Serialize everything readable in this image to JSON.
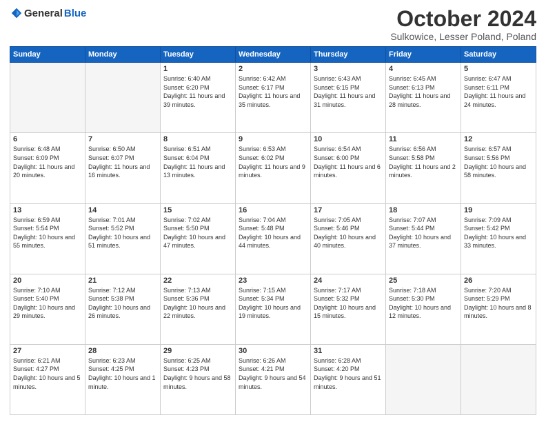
{
  "logo": {
    "general": "General",
    "blue": "Blue"
  },
  "header": {
    "month": "October 2024",
    "location": "Sulkowice, Lesser Poland, Poland"
  },
  "weekdays": [
    "Sunday",
    "Monday",
    "Tuesday",
    "Wednesday",
    "Thursday",
    "Friday",
    "Saturday"
  ],
  "weeks": [
    [
      {
        "day": "",
        "empty": true
      },
      {
        "day": "",
        "empty": true
      },
      {
        "day": "1",
        "sunrise": "Sunrise: 6:40 AM",
        "sunset": "Sunset: 6:20 PM",
        "daylight": "Daylight: 11 hours and 39 minutes."
      },
      {
        "day": "2",
        "sunrise": "Sunrise: 6:42 AM",
        "sunset": "Sunset: 6:17 PM",
        "daylight": "Daylight: 11 hours and 35 minutes."
      },
      {
        "day": "3",
        "sunrise": "Sunrise: 6:43 AM",
        "sunset": "Sunset: 6:15 PM",
        "daylight": "Daylight: 11 hours and 31 minutes."
      },
      {
        "day": "4",
        "sunrise": "Sunrise: 6:45 AM",
        "sunset": "Sunset: 6:13 PM",
        "daylight": "Daylight: 11 hours and 28 minutes."
      },
      {
        "day": "5",
        "sunrise": "Sunrise: 6:47 AM",
        "sunset": "Sunset: 6:11 PM",
        "daylight": "Daylight: 11 hours and 24 minutes."
      }
    ],
    [
      {
        "day": "6",
        "sunrise": "Sunrise: 6:48 AM",
        "sunset": "Sunset: 6:09 PM",
        "daylight": "Daylight: 11 hours and 20 minutes."
      },
      {
        "day": "7",
        "sunrise": "Sunrise: 6:50 AM",
        "sunset": "Sunset: 6:07 PM",
        "daylight": "Daylight: 11 hours and 16 minutes."
      },
      {
        "day": "8",
        "sunrise": "Sunrise: 6:51 AM",
        "sunset": "Sunset: 6:04 PM",
        "daylight": "Daylight: 11 hours and 13 minutes."
      },
      {
        "day": "9",
        "sunrise": "Sunrise: 6:53 AM",
        "sunset": "Sunset: 6:02 PM",
        "daylight": "Daylight: 11 hours and 9 minutes."
      },
      {
        "day": "10",
        "sunrise": "Sunrise: 6:54 AM",
        "sunset": "Sunset: 6:00 PM",
        "daylight": "Daylight: 11 hours and 6 minutes."
      },
      {
        "day": "11",
        "sunrise": "Sunrise: 6:56 AM",
        "sunset": "Sunset: 5:58 PM",
        "daylight": "Daylight: 11 hours and 2 minutes."
      },
      {
        "day": "12",
        "sunrise": "Sunrise: 6:57 AM",
        "sunset": "Sunset: 5:56 PM",
        "daylight": "Daylight: 10 hours and 58 minutes."
      }
    ],
    [
      {
        "day": "13",
        "sunrise": "Sunrise: 6:59 AM",
        "sunset": "Sunset: 5:54 PM",
        "daylight": "Daylight: 10 hours and 55 minutes."
      },
      {
        "day": "14",
        "sunrise": "Sunrise: 7:01 AM",
        "sunset": "Sunset: 5:52 PM",
        "daylight": "Daylight: 10 hours and 51 minutes."
      },
      {
        "day": "15",
        "sunrise": "Sunrise: 7:02 AM",
        "sunset": "Sunset: 5:50 PM",
        "daylight": "Daylight: 10 hours and 47 minutes."
      },
      {
        "day": "16",
        "sunrise": "Sunrise: 7:04 AM",
        "sunset": "Sunset: 5:48 PM",
        "daylight": "Daylight: 10 hours and 44 minutes."
      },
      {
        "day": "17",
        "sunrise": "Sunrise: 7:05 AM",
        "sunset": "Sunset: 5:46 PM",
        "daylight": "Daylight: 10 hours and 40 minutes."
      },
      {
        "day": "18",
        "sunrise": "Sunrise: 7:07 AM",
        "sunset": "Sunset: 5:44 PM",
        "daylight": "Daylight: 10 hours and 37 minutes."
      },
      {
        "day": "19",
        "sunrise": "Sunrise: 7:09 AM",
        "sunset": "Sunset: 5:42 PM",
        "daylight": "Daylight: 10 hours and 33 minutes."
      }
    ],
    [
      {
        "day": "20",
        "sunrise": "Sunrise: 7:10 AM",
        "sunset": "Sunset: 5:40 PM",
        "daylight": "Daylight: 10 hours and 29 minutes."
      },
      {
        "day": "21",
        "sunrise": "Sunrise: 7:12 AM",
        "sunset": "Sunset: 5:38 PM",
        "daylight": "Daylight: 10 hours and 26 minutes."
      },
      {
        "day": "22",
        "sunrise": "Sunrise: 7:13 AM",
        "sunset": "Sunset: 5:36 PM",
        "daylight": "Daylight: 10 hours and 22 minutes."
      },
      {
        "day": "23",
        "sunrise": "Sunrise: 7:15 AM",
        "sunset": "Sunset: 5:34 PM",
        "daylight": "Daylight: 10 hours and 19 minutes."
      },
      {
        "day": "24",
        "sunrise": "Sunrise: 7:17 AM",
        "sunset": "Sunset: 5:32 PM",
        "daylight": "Daylight: 10 hours and 15 minutes."
      },
      {
        "day": "25",
        "sunrise": "Sunrise: 7:18 AM",
        "sunset": "Sunset: 5:30 PM",
        "daylight": "Daylight: 10 hours and 12 minutes."
      },
      {
        "day": "26",
        "sunrise": "Sunrise: 7:20 AM",
        "sunset": "Sunset: 5:29 PM",
        "daylight": "Daylight: 10 hours and 8 minutes."
      }
    ],
    [
      {
        "day": "27",
        "sunrise": "Sunrise: 6:21 AM",
        "sunset": "Sunset: 4:27 PM",
        "daylight": "Daylight: 10 hours and 5 minutes."
      },
      {
        "day": "28",
        "sunrise": "Sunrise: 6:23 AM",
        "sunset": "Sunset: 4:25 PM",
        "daylight": "Daylight: 10 hours and 1 minute."
      },
      {
        "day": "29",
        "sunrise": "Sunrise: 6:25 AM",
        "sunset": "Sunset: 4:23 PM",
        "daylight": "Daylight: 9 hours and 58 minutes."
      },
      {
        "day": "30",
        "sunrise": "Sunrise: 6:26 AM",
        "sunset": "Sunset: 4:21 PM",
        "daylight": "Daylight: 9 hours and 54 minutes."
      },
      {
        "day": "31",
        "sunrise": "Sunrise: 6:28 AM",
        "sunset": "Sunset: 4:20 PM",
        "daylight": "Daylight: 9 hours and 51 minutes."
      },
      {
        "day": "",
        "empty": true
      },
      {
        "day": "",
        "empty": true
      }
    ]
  ]
}
